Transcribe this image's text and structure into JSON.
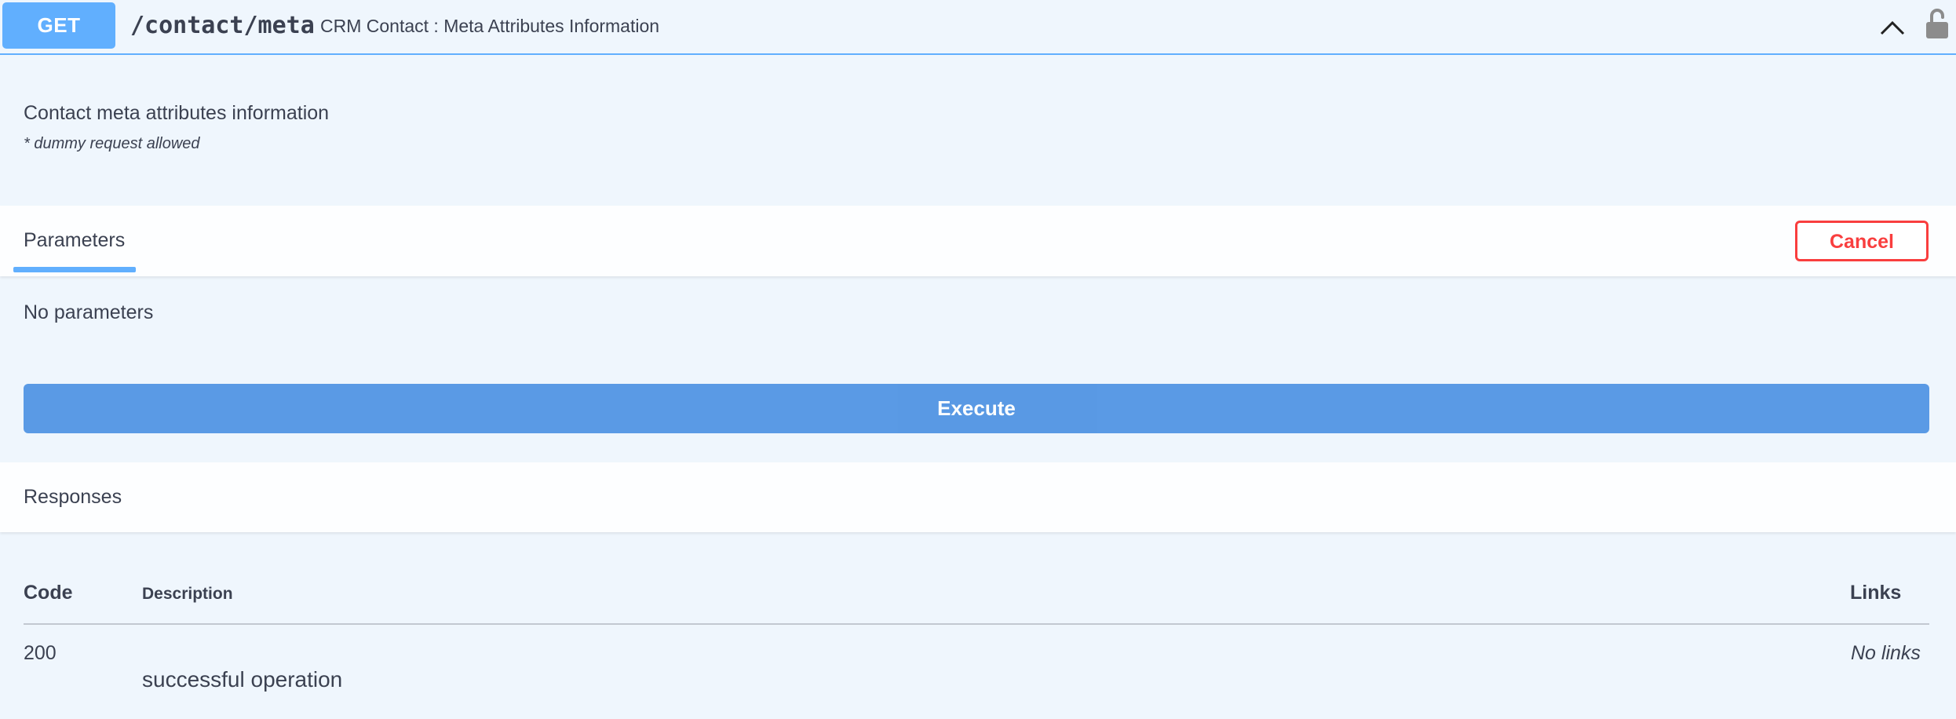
{
  "summary": {
    "method": "GET",
    "path": "/contact/meta",
    "description": "CRM Contact : Meta Attributes Information",
    "collapse_icon": "chevron-up-icon",
    "lock_icon": "unlocked-padlock-icon"
  },
  "description": {
    "title": "Contact meta attributes information",
    "note": "* dummy request allowed"
  },
  "parameters": {
    "tab_label": "Parameters",
    "cancel_label": "Cancel",
    "empty_text": "No parameters"
  },
  "execute": {
    "label": "Execute"
  },
  "responses": {
    "title": "Responses",
    "columns": {
      "code": "Code",
      "description": "Description",
      "links": "Links"
    },
    "rows": [
      {
        "code": "200",
        "description": "successful operation",
        "links": "No links"
      }
    ]
  },
  "colors": {
    "get_accent": "#61affe",
    "cancel_red": "#f93e3e",
    "execute_blue": "#4990e2",
    "background": "#eff6fd"
  }
}
